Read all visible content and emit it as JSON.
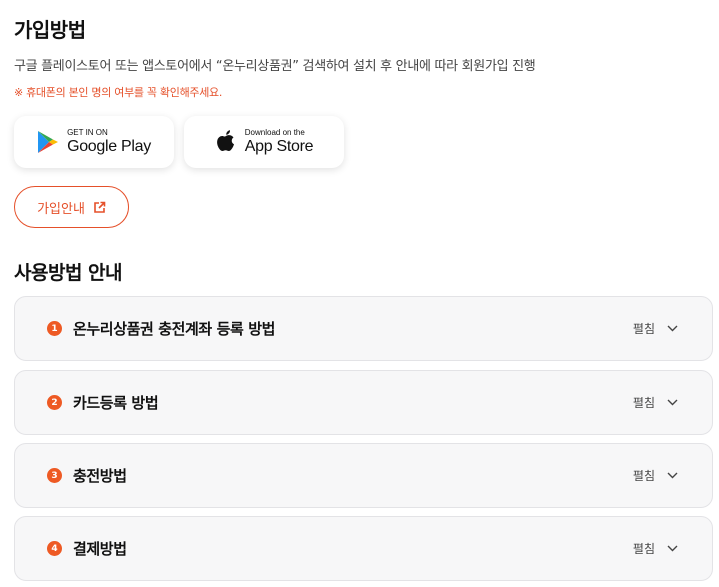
{
  "signup": {
    "title": "가입방법",
    "description": "구글 플레이스토어 또는 앱스토어에서 “온누리상품권” 검색하여 설치 후 안내에 따라 회원가입 진행",
    "notice": "※ 휴대폰의 본인 명의 여부를 꼭 확인해주세요.",
    "google_play": {
      "small": "GET IN ON",
      "big": "Google Play"
    },
    "app_store": {
      "small": "Download on the",
      "big": "App Store"
    },
    "join_label": "가입안내"
  },
  "usage": {
    "title": "사용방법 안내",
    "toggle_label": "펼침",
    "items": [
      {
        "num": "1",
        "label": "온누리상품권 충전계좌 등록 방법"
      },
      {
        "num": "2",
        "label": "카드등록 방법"
      },
      {
        "num": "3",
        "label": "충전방법"
      },
      {
        "num": "4",
        "label": "결제방법"
      }
    ]
  },
  "colors": {
    "accent": "#e5502a",
    "badge": "#ee5a24"
  },
  "icons": [
    "google-play-logo-icon",
    "apple-logo-icon",
    "external-link-icon",
    "chevron-down-icon"
  ]
}
